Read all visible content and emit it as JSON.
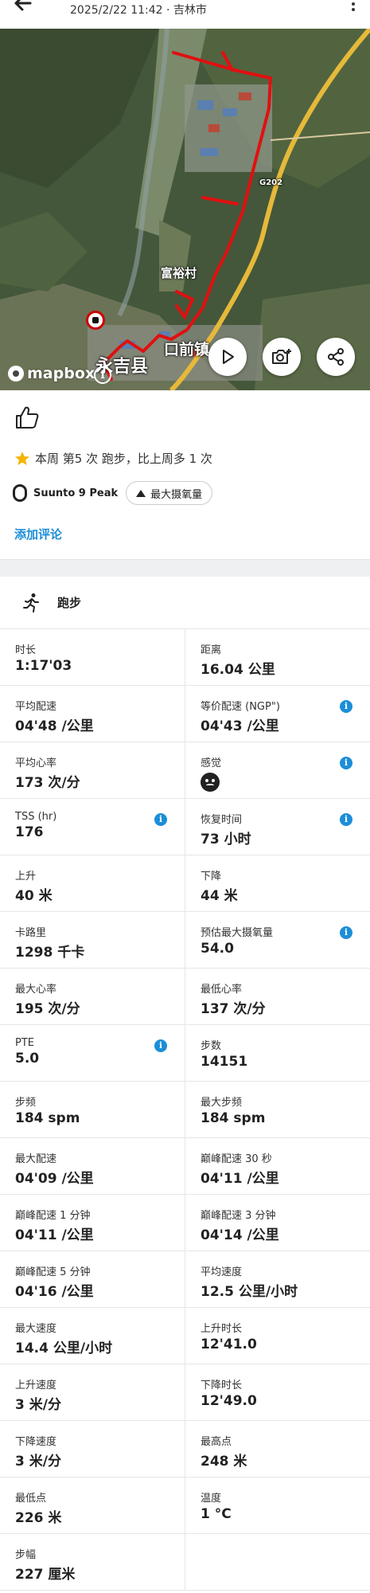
{
  "header": {
    "subtitle": "2025/2/22 11:42 · 吉林市"
  },
  "map": {
    "labels": {
      "village": "富裕村",
      "county": "永吉县",
      "town": "口前镇",
      "road": "G202"
    },
    "attribution": "mapbox",
    "info_glyph": "i",
    "route_color": "#e01010"
  },
  "summary": {
    "weekly_text": "本周 第5 次 跑步，比上周多 1 次",
    "device": "Suunto 9 Peak",
    "chip_label": "最大摄氧量",
    "add_comment": "添加评论"
  },
  "sport": {
    "label": "跑步"
  },
  "stats": [
    [
      {
        "label": "时长",
        "value": "1:17'03"
      },
      {
        "label": "距离",
        "value": "16.04 公里"
      }
    ],
    [
      {
        "label": "平均配速",
        "value": "04'48 /公里"
      },
      {
        "label": "等价配速 (NGP\")",
        "value": "04'43 /公里",
        "info": true
      }
    ],
    [
      {
        "label": "平均心率",
        "value": "173 次/分"
      },
      {
        "label": "感觉",
        "value": "",
        "face": true,
        "info": true
      }
    ],
    [
      {
        "label": "TSS (hr)",
        "value": "176",
        "info": true
      },
      {
        "label": "恢复时间",
        "value": "73 小时",
        "info": true
      }
    ],
    [
      {
        "label": "上升",
        "value": "40 米"
      },
      {
        "label": "下降",
        "value": "44 米"
      }
    ],
    [
      {
        "label": "卡路里",
        "value": "1298 千卡"
      },
      {
        "label": "预估最大摄氧量",
        "value": "54.0",
        "info": true
      }
    ],
    [
      {
        "label": "最大心率",
        "value": "195 次/分"
      },
      {
        "label": "最低心率",
        "value": "137 次/分"
      }
    ],
    [
      {
        "label": "PTE",
        "value": "5.0",
        "info": true
      },
      {
        "label": "步数",
        "value": "14151"
      }
    ],
    [
      {
        "label": "步频",
        "value": "184 spm"
      },
      {
        "label": "最大步频",
        "value": "184 spm"
      }
    ],
    [
      {
        "label": "最大配速",
        "value": "04'09 /公里"
      },
      {
        "label": "巅峰配速 30 秒",
        "value": "04'11 /公里"
      }
    ],
    [
      {
        "label": "巅峰配速 1 分钟",
        "value": "04'11 /公里"
      },
      {
        "label": "巅峰配速 3 分钟",
        "value": "04'14 /公里"
      }
    ],
    [
      {
        "label": "巅峰配速 5 分钟",
        "value": "04'16 /公里"
      },
      {
        "label": "平均速度",
        "value": "12.5 公里/小时"
      }
    ],
    [
      {
        "label": "最大速度",
        "value": "14.4 公里/小时"
      },
      {
        "label": "上升时长",
        "value": "12'41.0"
      }
    ],
    [
      {
        "label": "上升速度",
        "value": "3 米/分"
      },
      {
        "label": "下降时长",
        "value": "12'49.0"
      }
    ],
    [
      {
        "label": "下降速度",
        "value": "3 米/分"
      },
      {
        "label": "最高点",
        "value": "248 米"
      }
    ],
    [
      {
        "label": "最低点",
        "value": "226 米"
      },
      {
        "label": "温度",
        "value": "1 °C"
      }
    ],
    [
      {
        "label": "步幅",
        "value": "227 厘米"
      },
      {
        "label": "",
        "value": ""
      }
    ]
  ]
}
